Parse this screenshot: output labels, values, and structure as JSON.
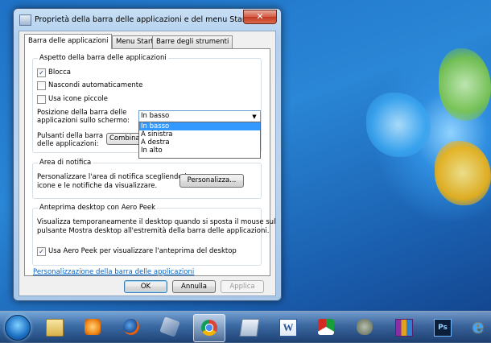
{
  "window": {
    "title": "Proprietà della barra delle applicazioni e del menu Start",
    "close_label": "✕"
  },
  "tabs": [
    {
      "label": "Barra delle applicazioni",
      "active": true
    },
    {
      "label": "Menu Start",
      "active": false
    },
    {
      "label": "Barre degli strumenti",
      "active": false
    }
  ],
  "appearance": {
    "title": "Aspetto della barra delle applicazioni",
    "lock": {
      "label": "Blocca",
      "checked": true,
      "mark": "✓"
    },
    "autohide": {
      "label": "Nascondi automaticamente",
      "checked": false
    },
    "small_icons": {
      "label": "Usa icone piccole",
      "checked": false
    },
    "position_label_1": "Posizione della barra delle",
    "position_label_2": "applicazioni sullo schermo:",
    "position_value": "In basso",
    "position_options": [
      "In basso",
      "A sinistra",
      "A destra",
      "In alto"
    ],
    "buttons_label_1": "Pulsanti della barra",
    "buttons_label_2": "delle applicazioni:",
    "buttons_value": "Combina s"
  },
  "notification": {
    "title": "Area di notifica",
    "desc_1": "Personalizzare l'area di notifica scegliendo le",
    "desc_2": "icone e le notifiche da visualizzare.",
    "customize_button": "Personalizza..."
  },
  "aero_peek": {
    "title": "Anteprima desktop con Aero Peek",
    "desc_1": "Visualizza temporaneamente il desktop quando si sposta il mouse sul",
    "desc_2": "pulsante Mostra desktop all'estremità della barra delle applicazioni.",
    "checkbox_label": "Usa Aero Peek per visualizzare l'anteprima del desktop",
    "checked": true,
    "mark": "✓"
  },
  "help_link": "Personalizzazione della barra delle applicazioni",
  "buttons": {
    "ok": "OK",
    "cancel": "Annulla",
    "apply": "Applica"
  },
  "taskbar": {
    "items": [
      "explorer-icon",
      "media-player-icon",
      "firefox-icon",
      "tools-icon",
      "chrome-icon",
      "notepad-icon",
      "word-icon",
      "app-icon",
      "evernote-icon",
      "winrar-icon",
      "photoshop-icon",
      "ie-icon"
    ],
    "word_glyph": "W",
    "ps_glyph": "Ps",
    "ie_glyph": "e"
  },
  "colors": {
    "accent": "#3399ff",
    "link": "#0066cc",
    "desktop": "#1f72c7"
  }
}
